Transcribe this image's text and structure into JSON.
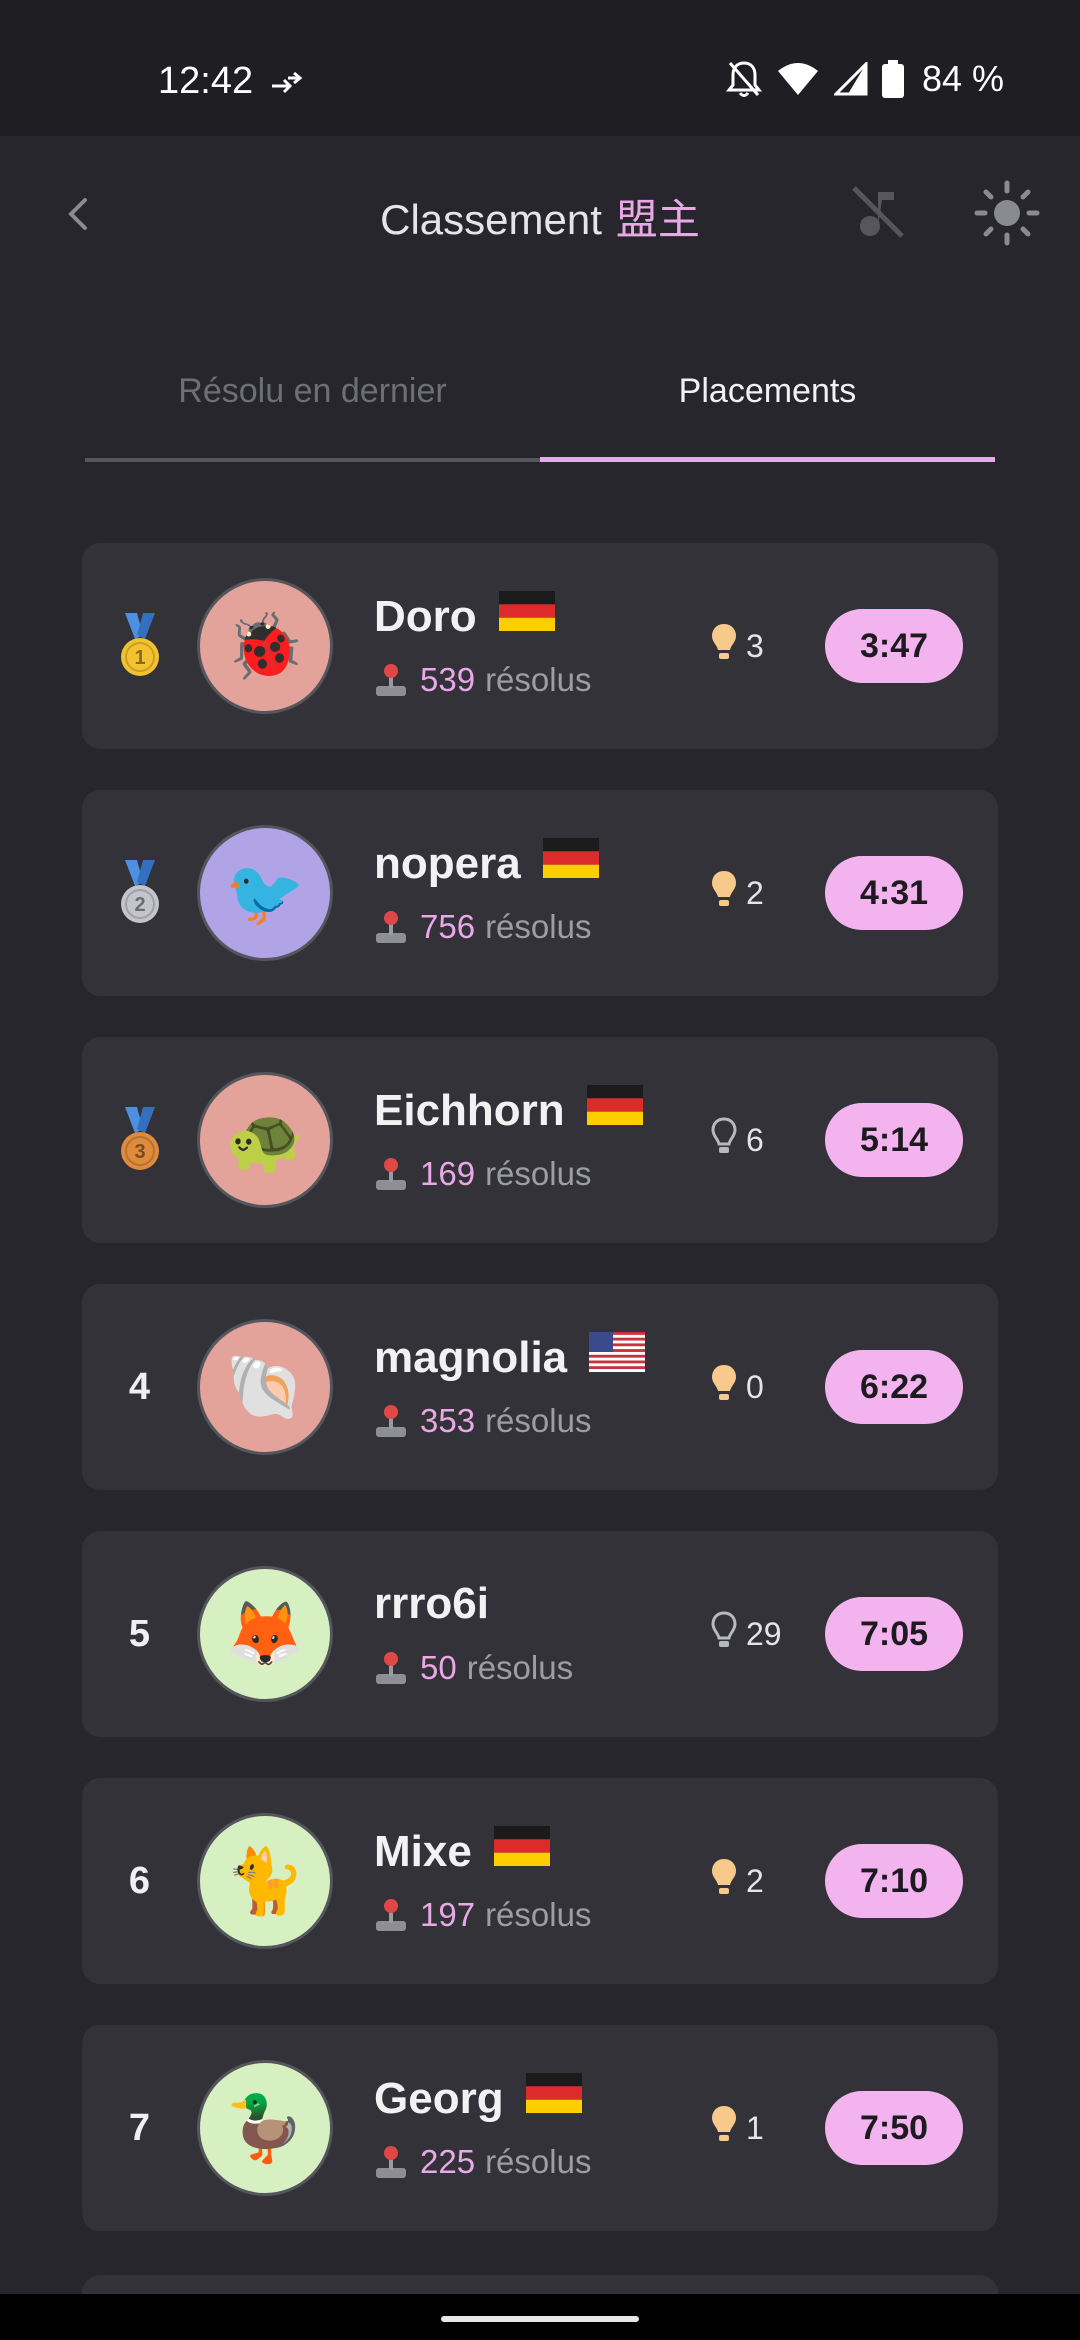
{
  "status_bar": {
    "time": "12:42",
    "battery": "84 %"
  },
  "header": {
    "title": "Classement",
    "title_accent": "盟主"
  },
  "tabs": [
    {
      "label": "Résolu en dernier",
      "active": false
    },
    {
      "label": "Placements",
      "active": true
    }
  ],
  "solved_suffix": "résolus",
  "rows": [
    {
      "rank": "1",
      "medal": "gold",
      "avatar": "🐞",
      "avatar_bg": "#e3a39a",
      "name": "Doro",
      "flag": "germany",
      "solved": "539",
      "hint_icon": "bulb-filled",
      "hints": "3",
      "time": "3:47"
    },
    {
      "rank": "2",
      "medal": "silver",
      "avatar": "🐦",
      "avatar_bg": "#b0a3e6",
      "name": "nopera",
      "flag": "germany",
      "solved": "756",
      "hint_icon": "bulb-filled",
      "hints": "2",
      "time": "4:31"
    },
    {
      "rank": "3",
      "medal": "bronze",
      "avatar": "🐢",
      "avatar_bg": "#e3a39a",
      "name": "Eichhorn",
      "flag": "germany",
      "solved": "169",
      "hint_icon": "bulb-outline",
      "hints": "6",
      "time": "5:14"
    },
    {
      "rank": "4",
      "medal": "",
      "avatar": "🐚",
      "avatar_bg": "#e3a39a",
      "name": "magnolia",
      "flag": "usa",
      "solved": "353",
      "hint_icon": "bulb-filled",
      "hints": "0",
      "time": "6:22"
    },
    {
      "rank": "5",
      "medal": "",
      "avatar": "🦊",
      "avatar_bg": "#d6f0c2",
      "name": "rrro6i",
      "flag": "",
      "solved": "50",
      "hint_icon": "bulb-outline",
      "hints": "29",
      "time": "7:05"
    },
    {
      "rank": "6",
      "medal": "",
      "avatar": "🐈",
      "avatar_bg": "#d6f0c2",
      "name": "Mixe",
      "flag": "germany",
      "solved": "197",
      "hint_icon": "bulb-filled",
      "hints": "2",
      "time": "7:10"
    },
    {
      "rank": "7",
      "medal": "",
      "avatar": "🦆",
      "avatar_bg": "#d6f0c2",
      "name": "Georg",
      "flag": "germany",
      "solved": "225",
      "hint_icon": "bulb-filled",
      "hints": "1",
      "time": "7:50"
    }
  ],
  "colors": {
    "accent": "#e9a8e6",
    "pill": "#f2b3ef",
    "card": "#323238",
    "background": "#26262c",
    "bulb": "#f7c98a"
  }
}
